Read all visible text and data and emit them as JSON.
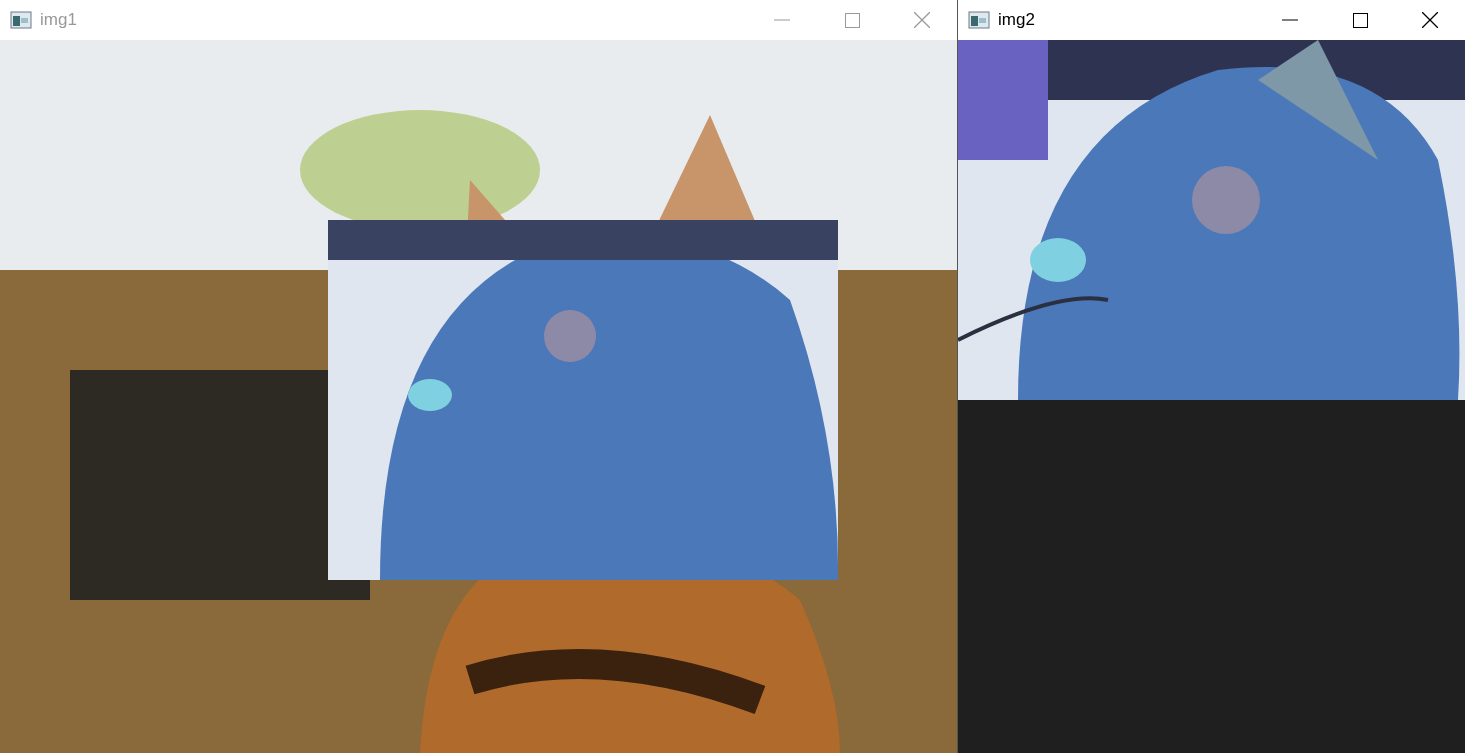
{
  "windows": [
    {
      "title": "img1",
      "active": false
    },
    {
      "title": "img2",
      "active": true
    }
  ]
}
